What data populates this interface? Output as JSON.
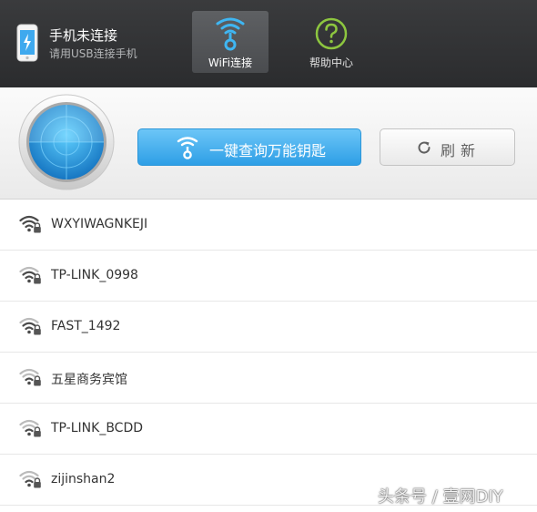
{
  "header": {
    "connection_title": "手机未连接",
    "connection_subtitle": "请用USB连接手机",
    "tabs": [
      {
        "label": "WiFi连接",
        "icon": "wifi-key-icon",
        "active": true,
        "accent": "#3fb6f2"
      },
      {
        "label": "帮助中心",
        "icon": "help-icon",
        "active": false,
        "accent": "#8dc63f"
      }
    ]
  },
  "actions": {
    "query_label": "一键查询万能钥匙",
    "query_icon": "wifi-key-icon",
    "refresh_label": "刷新",
    "refresh_icon": "refresh-icon"
  },
  "wifi_list": [
    {
      "ssid": "WXYIWAGNKEJI",
      "icon": "wifi-locked-icon",
      "signal": 4
    },
    {
      "ssid": "TP-LINK_0998",
      "icon": "wifi-locked-icon",
      "signal": 3
    },
    {
      "ssid": "FAST_1492",
      "icon": "wifi-locked-icon",
      "signal": 3
    },
    {
      "ssid": "五星商务宾馆",
      "icon": "wifi-locked-icon",
      "signal": 2
    },
    {
      "ssid": "TP-LINK_BCDD",
      "icon": "wifi-locked-icon",
      "signal": 2
    },
    {
      "ssid": "zijinshan2",
      "icon": "wifi-locked-icon",
      "signal": 2
    }
  ],
  "watermark": "头条号 / 壹网DIY",
  "colors": {
    "header_bg": "#333436",
    "primary_button": "#3aa8ec",
    "wifi_active": "#4a4a4a",
    "wifi_inactive": "#bbbbbb"
  }
}
